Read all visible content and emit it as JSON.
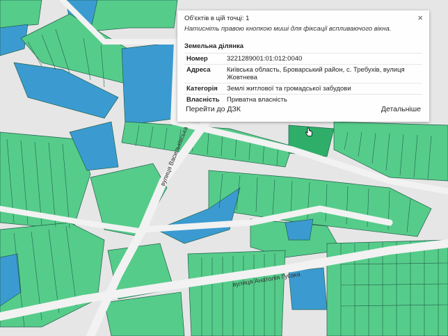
{
  "popup": {
    "count_label": "Об'єктів в цій точці: 1",
    "hint": "Натисніть правою кнопкою миші для фіксації вспливаючого вікна.",
    "section_title": "Земельна ділянка",
    "rows": [
      {
        "key": "Номер",
        "value": "3221289001:01:012:0040"
      },
      {
        "key": "Адреса",
        "value": "Київська область, Броварський район, с. Требухів, вулиця Жовтнева"
      },
      {
        "key": "Категорія",
        "value": "Землі житлової та громадської забудови"
      },
      {
        "key": "Власність",
        "value": "Приватна власність"
      }
    ],
    "link_dzk": "Перейти до ДЗК",
    "link_details": "Детальніше",
    "close_icon": "close-icon"
  },
  "map": {
    "streets": {
      "vasylkivska": "вулиця Васильківська",
      "gusaka": "вулиця Анатолія Гусака"
    },
    "colors": {
      "background": "#e6e6e6",
      "road": "#f2f2f2",
      "parcel_green": "#56cc8a",
      "parcel_blue": "#3b9bd1",
      "parcel_dark_green": "#2fae6a",
      "outline": "#1f5f4a"
    }
  }
}
